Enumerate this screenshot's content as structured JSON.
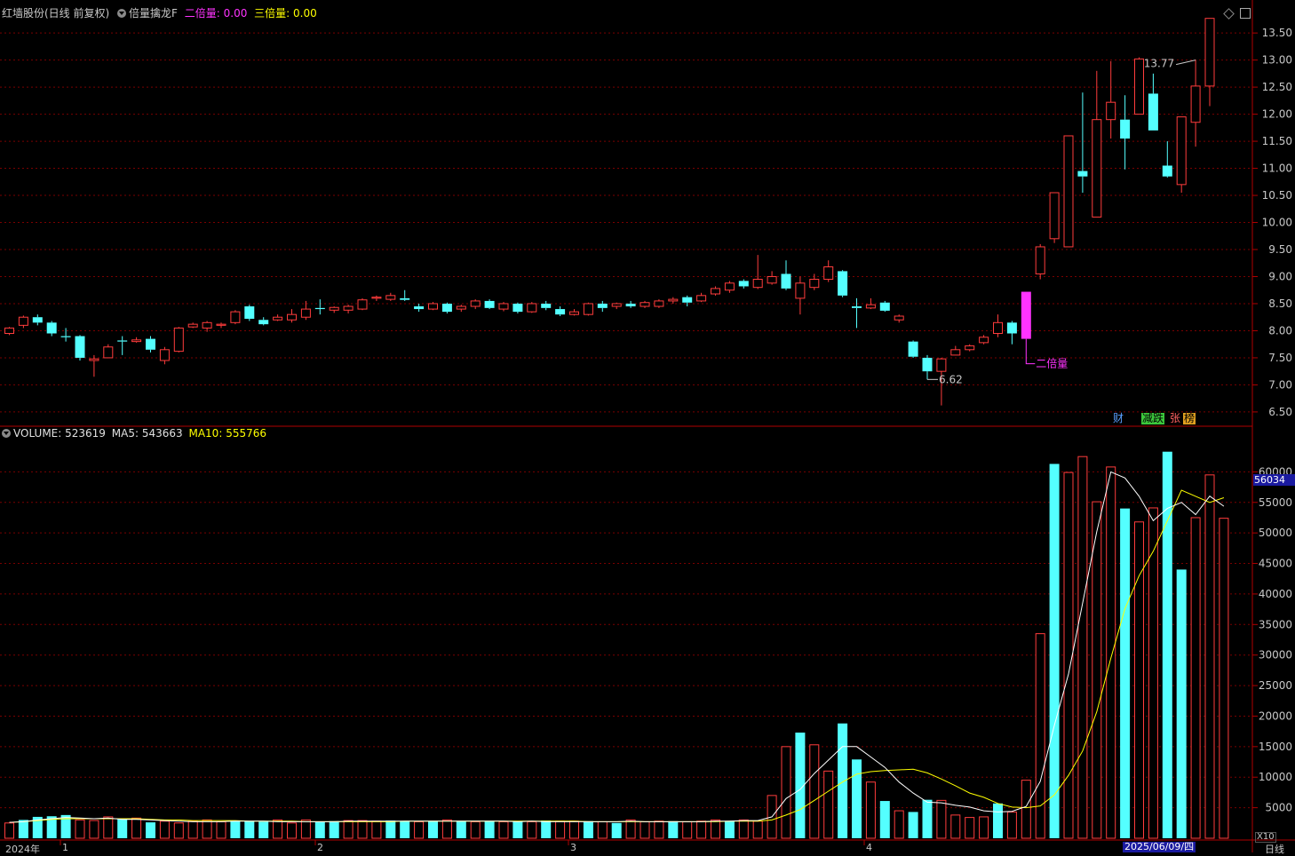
{
  "header": {
    "stock_title": "红墙股份(日线 前复权)",
    "indicator_name": "倍量擒龙F",
    "double_label": "二倍量:",
    "double_value": "0.00",
    "triple_label": "三倍量:",
    "triple_value": "0.00"
  },
  "volume_header": {
    "volume_label": "VOLUME:",
    "volume_value": "523619",
    "ma5_label": "MA5:",
    "ma5_value": "543663",
    "ma10_label": "MA10:",
    "ma10_value": "555766"
  },
  "info_buttons": {
    "finance": "财",
    "drop": "减跌",
    "limit": "张",
    "rank": "榜"
  },
  "x_axis": {
    "labels": [
      "2024年",
      "1",
      "2",
      "3",
      "4"
    ],
    "current_date": "2025/06/09/四",
    "period_label": "日线",
    "multiplier": "X10"
  },
  "colors": {
    "up": "#ff3c3c",
    "down": "#54ffff",
    "ma5": "#ffffff",
    "ma10": "#ffff00",
    "signal": "#ff33ff",
    "grid": "#7a0000"
  },
  "chart_data": [
    {
      "type": "candlestick",
      "title": "红墙股份(日线 前复权)",
      "yticks": [
        6.5,
        7.0,
        7.5,
        8.0,
        8.5,
        9.0,
        9.5,
        10.0,
        10.5,
        11.0,
        11.5,
        12.0,
        12.5,
        13.0,
        13.5
      ],
      "ylim": [
        6.4,
        13.65
      ],
      "annotations": {
        "high_label": "13.77",
        "low_label": "6.62",
        "signal_label": "二倍量"
      },
      "signal_index": 72,
      "low_index": 65,
      "high_index": 84,
      "candles": [
        [
          7.95,
          8.05,
          8.07,
          7.92
        ],
        [
          8.1,
          8.25,
          8.28,
          8.05
        ],
        [
          8.25,
          8.15,
          8.3,
          8.1
        ],
        [
          8.15,
          7.95,
          8.18,
          7.9
        ],
        [
          7.9,
          7.88,
          8.05,
          7.8
        ],
        [
          7.9,
          7.5,
          7.92,
          7.45
        ],
        [
          7.45,
          7.48,
          7.55,
          7.15
        ],
        [
          7.5,
          7.7,
          7.75,
          7.5
        ],
        [
          7.82,
          7.8,
          7.9,
          7.55
        ],
        [
          7.8,
          7.83,
          7.88,
          7.78
        ],
        [
          7.85,
          7.65,
          7.9,
          7.6
        ],
        [
          7.45,
          7.65,
          7.7,
          7.38
        ],
        [
          7.62,
          8.05,
          8.07,
          7.6
        ],
        [
          8.07,
          8.12,
          8.15,
          8.05
        ],
        [
          8.05,
          8.15,
          8.18,
          7.98
        ],
        [
          8.1,
          8.12,
          8.15,
          8.05
        ],
        [
          8.15,
          8.35,
          8.38,
          8.12
        ],
        [
          8.45,
          8.22,
          8.48,
          8.18
        ],
        [
          8.2,
          8.12,
          8.25,
          8.1
        ],
        [
          8.2,
          8.25,
          8.3,
          8.18
        ],
        [
          8.2,
          8.3,
          8.4,
          8.15
        ],
        [
          8.25,
          8.4,
          8.55,
          8.2
        ],
        [
          8.42,
          8.4,
          8.58,
          8.3
        ],
        [
          8.38,
          8.43,
          8.45,
          8.33
        ],
        [
          8.38,
          8.45,
          8.48,
          8.32
        ],
        [
          8.4,
          8.57,
          8.6,
          8.38
        ],
        [
          8.6,
          8.62,
          8.65,
          8.55
        ],
        [
          8.58,
          8.65,
          8.7,
          8.55
        ],
        [
          8.6,
          8.57,
          8.75,
          8.55
        ],
        [
          8.45,
          8.4,
          8.5,
          8.35
        ],
        [
          8.4,
          8.5,
          8.53,
          8.38
        ],
        [
          8.5,
          8.35,
          8.52,
          8.32
        ],
        [
          8.4,
          8.45,
          8.48,
          8.35
        ],
        [
          8.45,
          8.55,
          8.58,
          8.4
        ],
        [
          8.55,
          8.42,
          8.58,
          8.4
        ],
        [
          8.4,
          8.5,
          8.53,
          8.36
        ],
        [
          8.5,
          8.35,
          8.52,
          8.32
        ],
        [
          8.35,
          8.5,
          8.53,
          8.33
        ],
        [
          8.5,
          8.42,
          8.55,
          8.38
        ],
        [
          8.4,
          8.3,
          8.45,
          8.27
        ],
        [
          8.3,
          8.35,
          8.4,
          8.28
        ],
        [
          8.3,
          8.5,
          8.52,
          8.28
        ],
        [
          8.5,
          8.42,
          8.55,
          8.35
        ],
        [
          8.45,
          8.5,
          8.52,
          8.4
        ],
        [
          8.5,
          8.45,
          8.55,
          8.42
        ],
        [
          8.45,
          8.52,
          8.55,
          8.42
        ],
        [
          8.45,
          8.55,
          8.58,
          8.42
        ],
        [
          8.55,
          8.58,
          8.62,
          8.5
        ],
        [
          8.62,
          8.52,
          8.65,
          8.45
        ],
        [
          8.55,
          8.65,
          8.7,
          8.53
        ],
        [
          8.68,
          8.78,
          8.82,
          8.65
        ],
        [
          8.75,
          8.88,
          8.92,
          8.7
        ],
        [
          8.92,
          8.82,
          8.95,
          8.78
        ],
        [
          8.8,
          8.95,
          9.4,
          8.77
        ],
        [
          8.88,
          9.0,
          9.1,
          8.85
        ],
        [
          9.05,
          8.78,
          9.3,
          8.75
        ],
        [
          8.6,
          8.88,
          9.0,
          8.3
        ],
        [
          8.8,
          8.95,
          9.05,
          8.75
        ],
        [
          8.95,
          9.18,
          9.3,
          8.9
        ],
        [
          9.1,
          8.65,
          9.12,
          8.62
        ],
        [
          8.45,
          8.42,
          8.6,
          8.05
        ],
        [
          8.42,
          8.48,
          8.6,
          8.4
        ],
        [
          8.52,
          8.37,
          8.55,
          8.35
        ],
        [
          8.2,
          8.27,
          8.3,
          8.15
        ],
        [
          7.8,
          7.52,
          7.82,
          7.5
        ],
        [
          7.5,
          7.25,
          7.55,
          7.1
        ],
        [
          7.25,
          7.48,
          7.5,
          6.62
        ],
        [
          7.55,
          7.65,
          7.72,
          7.55
        ],
        [
          7.65,
          7.72,
          7.75,
          7.62
        ],
        [
          7.78,
          7.88,
          7.92,
          7.75
        ],
        [
          7.95,
          8.15,
          8.3,
          7.88
        ],
        [
          8.15,
          7.95,
          8.18,
          7.75
        ],
        [
          7.85,
          8.72,
          8.72,
          7.85
        ],
        [
          9.05,
          9.55,
          9.6,
          8.95
        ],
        [
          9.7,
          10.55,
          10.55,
          9.62
        ],
        [
          9.55,
          11.6,
          11.6,
          9.55
        ],
        [
          10.95,
          10.85,
          12.4,
          10.55
        ],
        [
          10.1,
          11.9,
          12.8,
          10.1
        ],
        [
          11.9,
          12.22,
          12.98,
          11.55
        ],
        [
          11.9,
          11.55,
          12.35,
          10.98
        ],
        [
          12.0,
          13.02,
          13.05,
          12.0
        ],
        [
          12.38,
          11.7,
          12.75,
          11.7
        ],
        [
          11.05,
          10.85,
          11.5,
          10.83
        ],
        [
          10.7,
          11.95,
          11.95,
          10.55
        ],
        [
          11.85,
          12.52,
          13.0,
          11.4
        ],
        [
          12.52,
          13.77,
          13.77,
          12.15
        ]
      ]
    },
    {
      "type": "bar",
      "title": "VOLUME",
      "yticks": [
        5000,
        10000,
        15000,
        20000,
        25000,
        30000,
        35000,
        40000,
        45000,
        50000,
        55000,
        60000
      ],
      "ylim": [
        0,
        65000
      ],
      "current_value_tag": "56034",
      "values": [
        2500,
        3000,
        3500,
        3600,
        3800,
        3000,
        2900,
        3500,
        3100,
        3300,
        2600,
        2800,
        2500,
        2800,
        3000,
        2700,
        2900,
        2800,
        2700,
        3000,
        2500,
        3000,
        2700,
        2800,
        2900,
        2900,
        2800,
        2900,
        2800,
        2700,
        2800,
        3000,
        2800,
        2700,
        2800,
        2700,
        2800,
        2700,
        2900,
        2800,
        2800,
        2800,
        2700,
        2500,
        3000,
        2700,
        2800,
        2800,
        2700,
        2800,
        3000,
        2800,
        3000,
        2800,
        7000,
        15000,
        17300,
        15300,
        11000,
        18800,
        12900,
        9200,
        6100,
        4500,
        4300,
        6300,
        6200,
        3800,
        3400,
        3500,
        5700,
        4300,
        9500,
        33500,
        61300,
        59900,
        62500,
        55100,
        60800,
        54000,
        51800,
        54100,
        63300,
        44000,
        52500,
        59500,
        52400
      ],
      "up": [
        1,
        0,
        0,
        0,
        0,
        1,
        1,
        1,
        0,
        1,
        0,
        1,
        1,
        1,
        1,
        1,
        0,
        0,
        0,
        1,
        1,
        1,
        0,
        0,
        1,
        1,
        1,
        0,
        0,
        1,
        0,
        1,
        0,
        1,
        0,
        1,
        0,
        1,
        0,
        1,
        1,
        0,
        1,
        0,
        1,
        1,
        1,
        0,
        1,
        1,
        1,
        0,
        1,
        1,
        1,
        1,
        0,
        1,
        1,
        0,
        0,
        1,
        0,
        1,
        0,
        0,
        1,
        1,
        1,
        1,
        0,
        1,
        1,
        1,
        0,
        1,
        1,
        1,
        1,
        0,
        1,
        1,
        0,
        0,
        1,
        1,
        1
      ],
      "ma5": [
        2600,
        2700,
        3000,
        3200,
        3400,
        3300,
        3200,
        3300,
        3100,
        3100,
        3000,
        2900,
        2800,
        2700,
        2700,
        2700,
        2800,
        2800,
        2800,
        2700,
        2700,
        2700,
        2700,
        2700,
        2800,
        2800,
        2800,
        2800,
        2800,
        2800,
        2800,
        2800,
        2800,
        2800,
        2800,
        2800,
        2700,
        2800,
        2700,
        2700,
        2700,
        2700,
        2700,
        2700,
        2800,
        2700,
        2700,
        2700,
        2700,
        2700,
        2800,
        2800,
        2900,
        2900,
        3500,
        6500,
        8000,
        10600,
        12800,
        15000,
        15000,
        13300,
        11600,
        9200,
        7400,
        5900,
        5800,
        5400,
        5100,
        4500,
        4300,
        4400,
        5200,
        9300,
        18500,
        26900,
        38500,
        50200,
        60000,
        59000,
        56000,
        52000,
        54000,
        55000,
        53000,
        56034,
        54366
      ],
      "ma10": [
        2600,
        2700,
        2900,
        3100,
        3200,
        3200,
        3200,
        3200,
        3200,
        3200,
        3100,
        3000,
        3000,
        2900,
        2900,
        2900,
        2900,
        2800,
        2800,
        2800,
        2800,
        2700,
        2700,
        2700,
        2700,
        2700,
        2700,
        2700,
        2800,
        2800,
        2800,
        2800,
        2800,
        2800,
        2800,
        2800,
        2800,
        2800,
        2800,
        2800,
        2800,
        2700,
        2700,
        2700,
        2700,
        2700,
        2700,
        2700,
        2700,
        2700,
        2700,
        2800,
        2800,
        2800,
        3000,
        3800,
        4700,
        6200,
        7700,
        9200,
        10500,
        10900,
        11100,
        11200,
        11300,
        10700,
        9700,
        8600,
        7400,
        6700,
        5700,
        5100,
        5000,
        5300,
        7100,
        10300,
        14300,
        20700,
        29500,
        37600,
        43000,
        47000,
        52000,
        57000,
        56000,
        55000,
        55766
      ]
    }
  ]
}
